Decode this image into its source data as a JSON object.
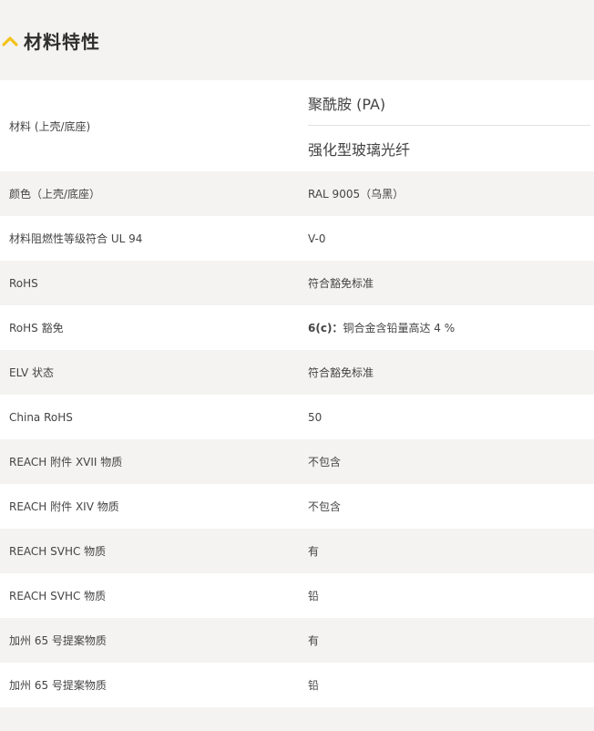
{
  "section": {
    "title": "材料特性",
    "icon": "chevron-up-icon",
    "accent": "#f3c31a"
  },
  "rows": [
    {
      "label": "材料 (上壳/底座)",
      "values": [
        "聚酰胺 (PA)",
        "强化型玻璃光纤"
      ]
    },
    {
      "label": "颜色（上壳/底座）",
      "value": "RAL 9005（乌黑）"
    },
    {
      "label": "材料阻燃性等级符合 UL 94",
      "value": "V-0"
    },
    {
      "label": "RoHS",
      "value": "符合豁免标准"
    },
    {
      "label": "RoHS 豁免",
      "value_bold": "6(c)：",
      "value": "铜合金含铅量高达 4 %"
    },
    {
      "label": "ELV 状态",
      "value": "符合豁免标准"
    },
    {
      "label": "China RoHS",
      "value": "50"
    },
    {
      "label": "REACH 附件 XVII 物质",
      "value": "不包含"
    },
    {
      "label": "REACH 附件 XIV 物质",
      "value": "不包含"
    },
    {
      "label": "REACH SVHC 物质",
      "value": "有"
    },
    {
      "label": "REACH SVHC 物质",
      "value": "铅"
    },
    {
      "label": "加州 65 号提案物质",
      "value": "有"
    },
    {
      "label": "加州 65 号提案物质",
      "value": "铅"
    }
  ]
}
